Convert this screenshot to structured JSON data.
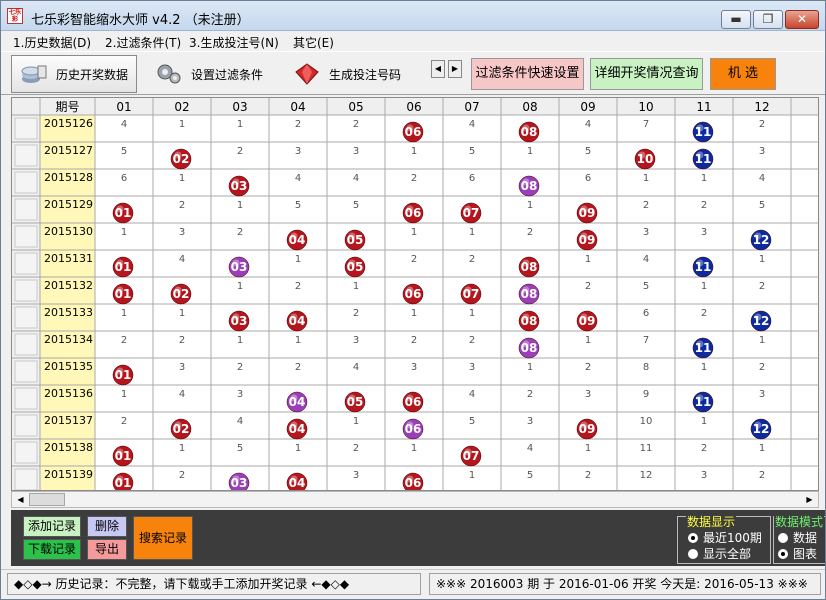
{
  "window": {
    "title": "七乐彩智能缩水大师 v4.2 （未注册）",
    "app_icon_text": "七乐彩",
    "min_glyph": "▬",
    "max_glyph": "❐",
    "close_glyph": "✕"
  },
  "menu": [
    {
      "label": "1.历史数据(D)"
    },
    {
      "label": "2.过滤条件(T)"
    },
    {
      "label": "3.生成投注号(N)"
    },
    {
      "label": "其它(E)"
    }
  ],
  "toolbar": {
    "history": "历史开奖数据",
    "filter": "设置过滤条件",
    "generate": "生成投注号码",
    "scroll_left": "◀",
    "scroll_right": "▶",
    "quick_filter": "过滤条件快速设置",
    "detail": "详细开奖情况查询",
    "random": "机 选"
  },
  "grid": {
    "header_period": "期号",
    "columns": [
      "01",
      "02",
      "03",
      "04",
      "05",
      "06",
      "07",
      "08",
      "09",
      "10",
      "11",
      "12"
    ],
    "rows": [
      {
        "period": "2015126",
        "cells": [
          "4",
          "1",
          "1",
          "2",
          "2",
          {
            "b": "06",
            "c": "r"
          },
          "4",
          {
            "b": "08",
            "c": "r"
          },
          "4",
          "7",
          {
            "b": "11",
            "c": "b"
          },
          "2"
        ]
      },
      {
        "period": "2015127",
        "cells": [
          "5",
          {
            "b": "02",
            "c": "r"
          },
          "2",
          "3",
          "3",
          "1",
          "5",
          "1",
          "5",
          {
            "b": "10",
            "c": "r"
          },
          {
            "b": "11",
            "c": "b"
          },
          "3"
        ]
      },
      {
        "period": "2015128",
        "cells": [
          "6",
          "1",
          {
            "b": "03",
            "c": "r"
          },
          "4",
          "4",
          "2",
          "6",
          {
            "b": "08",
            "c": "p"
          },
          "6",
          "1",
          "1",
          "4"
        ]
      },
      {
        "period": "2015129",
        "cells": [
          {
            "b": "01",
            "c": "r"
          },
          "2",
          "1",
          "5",
          "5",
          {
            "b": "06",
            "c": "r"
          },
          {
            "b": "07",
            "c": "r"
          },
          "1",
          {
            "b": "09",
            "c": "r"
          },
          "2",
          "2",
          "5"
        ]
      },
      {
        "period": "2015130",
        "cells": [
          "1",
          "3",
          "2",
          {
            "b": "04",
            "c": "r"
          },
          {
            "b": "05",
            "c": "r"
          },
          "1",
          "1",
          "2",
          {
            "b": "09",
            "c": "r"
          },
          "3",
          "3",
          {
            "b": "12",
            "c": "b"
          }
        ]
      },
      {
        "period": "2015131",
        "cells": [
          {
            "b": "01",
            "c": "r"
          },
          "4",
          {
            "b": "03",
            "c": "p"
          },
          "1",
          {
            "b": "05",
            "c": "r"
          },
          "2",
          "2",
          {
            "b": "08",
            "c": "r"
          },
          "1",
          "4",
          {
            "b": "11",
            "c": "b"
          },
          "1"
        ]
      },
      {
        "period": "2015132",
        "cells": [
          {
            "b": "01",
            "c": "r"
          },
          {
            "b": "02",
            "c": "r"
          },
          "1",
          "2",
          "1",
          {
            "b": "06",
            "c": "r"
          },
          {
            "b": "07",
            "c": "r"
          },
          {
            "b": "08",
            "c": "p"
          },
          "2",
          "5",
          "1",
          "2"
        ]
      },
      {
        "period": "2015133",
        "cells": [
          "1",
          "1",
          {
            "b": "03",
            "c": "r"
          },
          {
            "b": "04",
            "c": "r"
          },
          "2",
          "1",
          "1",
          {
            "b": "08",
            "c": "r"
          },
          {
            "b": "09",
            "c": "r"
          },
          "6",
          "2",
          {
            "b": "12",
            "c": "b"
          }
        ]
      },
      {
        "period": "2015134",
        "cells": [
          "2",
          "2",
          "1",
          "1",
          "3",
          "2",
          "2",
          {
            "b": "08",
            "c": "p"
          },
          "1",
          "7",
          {
            "b": "11",
            "c": "b"
          },
          "1"
        ]
      },
      {
        "period": "2015135",
        "cells": [
          {
            "b": "01",
            "c": "r"
          },
          "3",
          "2",
          "2",
          "4",
          "3",
          "3",
          "1",
          "2",
          "8",
          "1",
          "2"
        ]
      },
      {
        "period": "2015136",
        "cells": [
          "1",
          "4",
          "3",
          {
            "b": "04",
            "c": "p"
          },
          {
            "b": "05",
            "c": "r"
          },
          {
            "b": "06",
            "c": "r"
          },
          "4",
          "2",
          "3",
          "9",
          {
            "b": "11",
            "c": "b"
          },
          "3"
        ]
      },
      {
        "period": "2015137",
        "cells": [
          "2",
          {
            "b": "02",
            "c": "r"
          },
          "4",
          {
            "b": "04",
            "c": "r"
          },
          "1",
          {
            "b": "06",
            "c": "p"
          },
          "5",
          "3",
          {
            "b": "09",
            "c": "r"
          },
          "10",
          "1",
          {
            "b": "12",
            "c": "b"
          }
        ]
      },
      {
        "period": "2015138",
        "cells": [
          {
            "b": "01",
            "c": "r"
          },
          "1",
          "5",
          "1",
          "2",
          "1",
          {
            "b": "07",
            "c": "r"
          },
          "4",
          "1",
          "11",
          "2",
          "1"
        ]
      },
      {
        "period": "2015139",
        "cells": [
          {
            "b": "01",
            "c": "r"
          },
          "2",
          {
            "b": "03",
            "c": "p"
          },
          {
            "b": "04",
            "c": "r"
          },
          "3",
          {
            "b": "06",
            "c": "r"
          },
          "1",
          "5",
          "2",
          "12",
          "3",
          "2"
        ]
      }
    ],
    "colors": {
      "r": "#b5151c",
      "b": "#0d2a9e",
      "p": "#9b3fb8"
    }
  },
  "hscroll": {
    "left": "◀",
    "right": "▶"
  },
  "bottom": {
    "add": "添加记录",
    "delete": "删除",
    "download": "下载记录",
    "export": "导出",
    "search": "搜索记录",
    "display_group": {
      "title": "数据显示",
      "opt1": "最近100期",
      "opt2": "显示全部"
    },
    "mode_group": {
      "title": "数据模式",
      "opt1": "数据",
      "opt2": "图表"
    }
  },
  "status": {
    "left": "◆◇◆→ 历史记录：不完整，请下载或手工添加开奖记录 ←◆◇◆",
    "right": "※※※  2016003 期 于 2016-01-06 开奖    今天是:   2016-05-13  ※※※"
  }
}
